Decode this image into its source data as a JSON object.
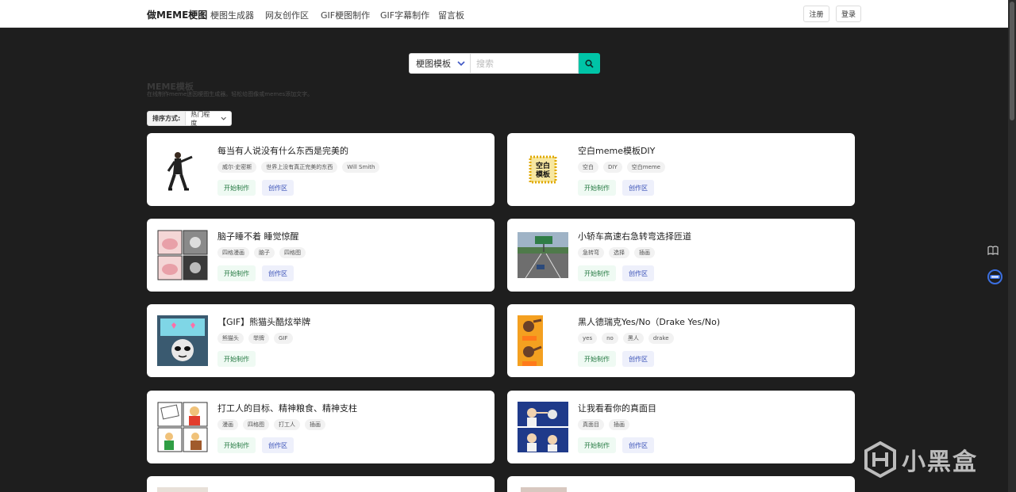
{
  "nav": {
    "brand": "做MEME梗图",
    "links": [
      "梗图生成器",
      "网友创作区",
      "GIF梗图制作",
      "GIF字幕制作",
      "留言板"
    ],
    "register": "注册",
    "login": "登录"
  },
  "search": {
    "select_label": "梗图模板",
    "placeholder": "搜索"
  },
  "section": {
    "title": "MEME模板",
    "subtitle": "在线制作meme迷因梗图生成器。轻松给图像或memes添加文字。"
  },
  "sort": {
    "label": "排序方式:",
    "value": "热门程度"
  },
  "buttons": {
    "start": "开始制作",
    "zone": "创作区"
  },
  "cards": [
    {
      "title": "每当有人说没有什么东西是完美的",
      "tags": [
        "威尔·史密斯",
        "世界上没有真正完美的东西",
        "Will Smith"
      ],
      "has_zone": true
    },
    {
      "title": "空白meme模板DIY",
      "tags": [
        "空白",
        "DIY",
        "空白meme"
      ],
      "has_zone": true,
      "thumb_text": [
        "空白",
        "模板"
      ]
    },
    {
      "title": "脑子睡不着 睡觉惊醒",
      "tags": [
        "四格漫画",
        "脑子",
        "四格图"
      ],
      "has_zone": true
    },
    {
      "title": "小轿车高速右急转弯选择匝道",
      "tags": [
        "急转弯",
        "选择",
        "插画"
      ],
      "has_zone": true
    },
    {
      "title": "【GIF】熊猫头酷炫举牌",
      "tags": [
        "熊猫头",
        "举牌",
        "GIF"
      ],
      "has_zone": false
    },
    {
      "title": "黑人德瑞克Yes/No（Drake Yes/No)",
      "tags": [
        "yes",
        "no",
        "黑人",
        "drake"
      ],
      "has_zone": true
    },
    {
      "title": "打工人的目标、精神粮食、精神支柱",
      "tags": [
        "漫画",
        "四格图",
        "打工人",
        "插画"
      ],
      "has_zone": true
    },
    {
      "title": "让我看看你的真面目",
      "tags": [
        "真面目",
        "插画"
      ],
      "has_zone": true
    }
  ],
  "watermark": "小黑盒"
}
